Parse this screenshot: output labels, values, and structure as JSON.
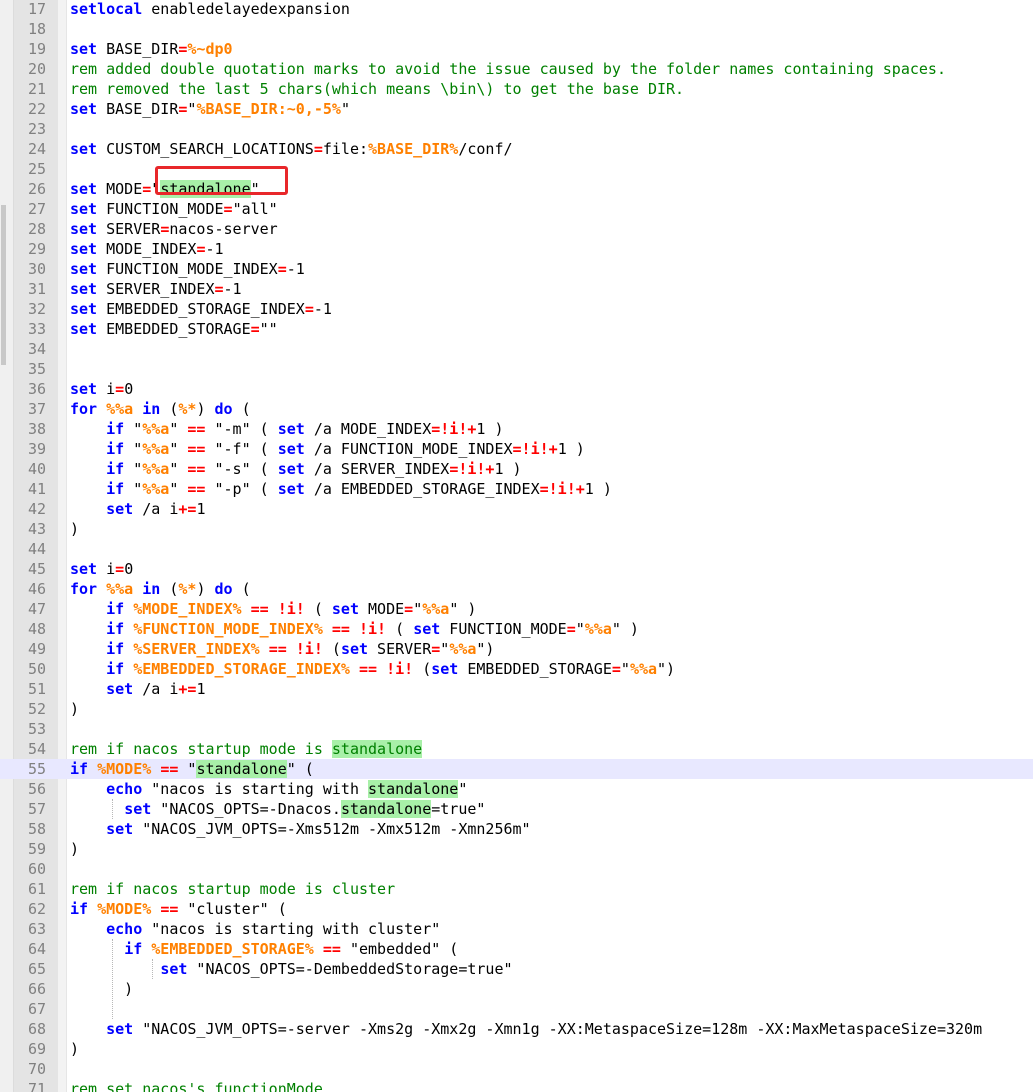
{
  "code_lines": [
    {
      "num": "17",
      "tokens": [
        {
          "c": "kw",
          "t": "setlocal"
        },
        {
          "c": "",
          "t": " enabledelayedexpansion"
        }
      ]
    },
    {
      "num": "18",
      "tokens": []
    },
    {
      "num": "19",
      "tokens": [
        {
          "c": "kw",
          "t": "set"
        },
        {
          "c": "",
          "t": " BASE_DIR"
        },
        {
          "c": "op",
          "t": "="
        },
        {
          "c": "var",
          "t": "%~dp0"
        }
      ]
    },
    {
      "num": "20",
      "tokens": [
        {
          "c": "rem",
          "t": "rem added double quotation marks to avoid the issue caused by the folder names containing spaces."
        }
      ]
    },
    {
      "num": "21",
      "tokens": [
        {
          "c": "rem",
          "t": "rem removed the last 5 chars(which means \\bin\\) to get the base DIR."
        }
      ]
    },
    {
      "num": "22",
      "tokens": [
        {
          "c": "kw",
          "t": "set"
        },
        {
          "c": "",
          "t": " BASE_DIR"
        },
        {
          "c": "op",
          "t": "="
        },
        {
          "c": "",
          "t": "\""
        },
        {
          "c": "var",
          "t": "%BASE_DIR:~0,-5%"
        },
        {
          "c": "",
          "t": "\""
        }
      ]
    },
    {
      "num": "23",
      "tokens": []
    },
    {
      "num": "24",
      "tokens": [
        {
          "c": "kw",
          "t": "set"
        },
        {
          "c": "",
          "t": " CUSTOM_SEARCH_LOCATIONS"
        },
        {
          "c": "op",
          "t": "="
        },
        {
          "c": "",
          "t": "file:"
        },
        {
          "c": "var",
          "t": "%BASE_DIR%"
        },
        {
          "c": "",
          "t": "/conf/"
        }
      ]
    },
    {
      "num": "25",
      "tokens": []
    },
    {
      "num": "26",
      "tokens": [
        {
          "c": "kw",
          "t": "set"
        },
        {
          "c": "",
          "t": " MODE"
        },
        {
          "c": "op",
          "t": "="
        },
        {
          "c": "",
          "t": "\""
        },
        {
          "c": "hl",
          "t": "standalone"
        },
        {
          "c": "",
          "t": "\""
        }
      ]
    },
    {
      "num": "27",
      "tokens": [
        {
          "c": "kw",
          "t": "set"
        },
        {
          "c": "",
          "t": " FUNCTION_MODE"
        },
        {
          "c": "op",
          "t": "="
        },
        {
          "c": "",
          "t": "\"all\""
        }
      ]
    },
    {
      "num": "28",
      "tokens": [
        {
          "c": "kw",
          "t": "set"
        },
        {
          "c": "",
          "t": " SERVER"
        },
        {
          "c": "op",
          "t": "="
        },
        {
          "c": "",
          "t": "nacos-server"
        }
      ]
    },
    {
      "num": "29",
      "tokens": [
        {
          "c": "kw",
          "t": "set"
        },
        {
          "c": "",
          "t": " MODE_INDEX"
        },
        {
          "c": "op",
          "t": "="
        },
        {
          "c": "",
          "t": "-1"
        }
      ]
    },
    {
      "num": "30",
      "tokens": [
        {
          "c": "kw",
          "t": "set"
        },
        {
          "c": "",
          "t": " FUNCTION_MODE_INDEX"
        },
        {
          "c": "op",
          "t": "="
        },
        {
          "c": "",
          "t": "-1"
        }
      ]
    },
    {
      "num": "31",
      "tokens": [
        {
          "c": "kw",
          "t": "set"
        },
        {
          "c": "",
          "t": " SERVER_INDEX"
        },
        {
          "c": "op",
          "t": "="
        },
        {
          "c": "",
          "t": "-1"
        }
      ]
    },
    {
      "num": "32",
      "tokens": [
        {
          "c": "kw",
          "t": "set"
        },
        {
          "c": "",
          "t": " EMBEDDED_STORAGE_INDEX"
        },
        {
          "c": "op",
          "t": "="
        },
        {
          "c": "",
          "t": "-1"
        }
      ]
    },
    {
      "num": "33",
      "tokens": [
        {
          "c": "kw",
          "t": "set"
        },
        {
          "c": "",
          "t": " EMBEDDED_STORAGE"
        },
        {
          "c": "op",
          "t": "="
        },
        {
          "c": "",
          "t": "\"\""
        }
      ]
    },
    {
      "num": "34",
      "tokens": []
    },
    {
      "num": "35",
      "tokens": []
    },
    {
      "num": "36",
      "tokens": [
        {
          "c": "kw",
          "t": "set"
        },
        {
          "c": "",
          "t": " i"
        },
        {
          "c": "op",
          "t": "="
        },
        {
          "c": "",
          "t": "0"
        }
      ]
    },
    {
      "num": "37",
      "tokens": [
        {
          "c": "kw",
          "t": "for"
        },
        {
          "c": "",
          "t": " "
        },
        {
          "c": "var",
          "t": "%%a"
        },
        {
          "c": "",
          "t": " "
        },
        {
          "c": "kw",
          "t": "in"
        },
        {
          "c": "",
          "t": " ("
        },
        {
          "c": "var",
          "t": "%*"
        },
        {
          "c": "",
          "t": ") "
        },
        {
          "c": "kw",
          "t": "do"
        },
        {
          "c": "",
          "t": " ("
        }
      ]
    },
    {
      "num": "38",
      "tokens": [
        {
          "c": "",
          "t": "    "
        },
        {
          "c": "kw",
          "t": "if"
        },
        {
          "c": "",
          "t": " \""
        },
        {
          "c": "var",
          "t": "%%a"
        },
        {
          "c": "",
          "t": "\" "
        },
        {
          "c": "op",
          "t": "=="
        },
        {
          "c": "",
          "t": " \"-m\" ( "
        },
        {
          "c": "kw",
          "t": "set"
        },
        {
          "c": "",
          "t": " /a MODE_INDEX"
        },
        {
          "c": "op",
          "t": "=!i!+"
        },
        {
          "c": "",
          "t": "1 )"
        }
      ]
    },
    {
      "num": "39",
      "tokens": [
        {
          "c": "",
          "t": "    "
        },
        {
          "c": "kw",
          "t": "if"
        },
        {
          "c": "",
          "t": " \""
        },
        {
          "c": "var",
          "t": "%%a"
        },
        {
          "c": "",
          "t": "\" "
        },
        {
          "c": "op",
          "t": "=="
        },
        {
          "c": "",
          "t": " \"-f\" ( "
        },
        {
          "c": "kw",
          "t": "set"
        },
        {
          "c": "",
          "t": " /a FUNCTION_MODE_INDEX"
        },
        {
          "c": "op",
          "t": "=!i!+"
        },
        {
          "c": "",
          "t": "1 )"
        }
      ]
    },
    {
      "num": "40",
      "tokens": [
        {
          "c": "",
          "t": "    "
        },
        {
          "c": "kw",
          "t": "if"
        },
        {
          "c": "",
          "t": " \""
        },
        {
          "c": "var",
          "t": "%%a"
        },
        {
          "c": "",
          "t": "\" "
        },
        {
          "c": "op",
          "t": "=="
        },
        {
          "c": "",
          "t": " \"-s\" ( "
        },
        {
          "c": "kw",
          "t": "set"
        },
        {
          "c": "",
          "t": " /a SERVER_INDEX"
        },
        {
          "c": "op",
          "t": "=!i!+"
        },
        {
          "c": "",
          "t": "1 )"
        }
      ]
    },
    {
      "num": "41",
      "tokens": [
        {
          "c": "",
          "t": "    "
        },
        {
          "c": "kw",
          "t": "if"
        },
        {
          "c": "",
          "t": " \""
        },
        {
          "c": "var",
          "t": "%%a"
        },
        {
          "c": "",
          "t": "\" "
        },
        {
          "c": "op",
          "t": "=="
        },
        {
          "c": "",
          "t": " \"-p\" ( "
        },
        {
          "c": "kw",
          "t": "set"
        },
        {
          "c": "",
          "t": " /a EMBEDDED_STORAGE_INDEX"
        },
        {
          "c": "op",
          "t": "=!i!+"
        },
        {
          "c": "",
          "t": "1 )"
        }
      ]
    },
    {
      "num": "42",
      "tokens": [
        {
          "c": "",
          "t": "    "
        },
        {
          "c": "kw",
          "t": "set"
        },
        {
          "c": "",
          "t": " /a i"
        },
        {
          "c": "op",
          "t": "+="
        },
        {
          "c": "",
          "t": "1"
        }
      ]
    },
    {
      "num": "43",
      "tokens": [
        {
          "c": "",
          "t": ")"
        }
      ]
    },
    {
      "num": "44",
      "tokens": []
    },
    {
      "num": "45",
      "tokens": [
        {
          "c": "kw",
          "t": "set"
        },
        {
          "c": "",
          "t": " i"
        },
        {
          "c": "op",
          "t": "="
        },
        {
          "c": "",
          "t": "0"
        }
      ]
    },
    {
      "num": "46",
      "tokens": [
        {
          "c": "kw",
          "t": "for"
        },
        {
          "c": "",
          "t": " "
        },
        {
          "c": "var",
          "t": "%%a"
        },
        {
          "c": "",
          "t": " "
        },
        {
          "c": "kw",
          "t": "in"
        },
        {
          "c": "",
          "t": " ("
        },
        {
          "c": "var",
          "t": "%*"
        },
        {
          "c": "",
          "t": ") "
        },
        {
          "c": "kw",
          "t": "do"
        },
        {
          "c": "",
          "t": " ("
        }
      ]
    },
    {
      "num": "47",
      "tokens": [
        {
          "c": "",
          "t": "    "
        },
        {
          "c": "kw",
          "t": "if"
        },
        {
          "c": "",
          "t": " "
        },
        {
          "c": "var",
          "t": "%MODE_INDEX%"
        },
        {
          "c": "",
          "t": " "
        },
        {
          "c": "op",
          "t": "== !i!"
        },
        {
          "c": "",
          "t": " ( "
        },
        {
          "c": "kw",
          "t": "set"
        },
        {
          "c": "",
          "t": " MODE"
        },
        {
          "c": "op",
          "t": "="
        },
        {
          "c": "",
          "t": "\""
        },
        {
          "c": "var",
          "t": "%%a"
        },
        {
          "c": "",
          "t": "\" )"
        }
      ]
    },
    {
      "num": "48",
      "tokens": [
        {
          "c": "",
          "t": "    "
        },
        {
          "c": "kw",
          "t": "if"
        },
        {
          "c": "",
          "t": " "
        },
        {
          "c": "var",
          "t": "%FUNCTION_MODE_INDEX%"
        },
        {
          "c": "",
          "t": " "
        },
        {
          "c": "op",
          "t": "== !i!"
        },
        {
          "c": "",
          "t": " ( "
        },
        {
          "c": "kw",
          "t": "set"
        },
        {
          "c": "",
          "t": " FUNCTION_MODE"
        },
        {
          "c": "op",
          "t": "="
        },
        {
          "c": "",
          "t": "\""
        },
        {
          "c": "var",
          "t": "%%a"
        },
        {
          "c": "",
          "t": "\" )"
        }
      ]
    },
    {
      "num": "49",
      "tokens": [
        {
          "c": "",
          "t": "    "
        },
        {
          "c": "kw",
          "t": "if"
        },
        {
          "c": "",
          "t": " "
        },
        {
          "c": "var",
          "t": "%SERVER_INDEX%"
        },
        {
          "c": "",
          "t": " "
        },
        {
          "c": "op",
          "t": "== !i!"
        },
        {
          "c": "",
          "t": " ("
        },
        {
          "c": "kw",
          "t": "set"
        },
        {
          "c": "",
          "t": " SERVER"
        },
        {
          "c": "op",
          "t": "="
        },
        {
          "c": "",
          "t": "\""
        },
        {
          "c": "var",
          "t": "%%a"
        },
        {
          "c": "",
          "t": "\")"
        }
      ]
    },
    {
      "num": "50",
      "tokens": [
        {
          "c": "",
          "t": "    "
        },
        {
          "c": "kw",
          "t": "if"
        },
        {
          "c": "",
          "t": " "
        },
        {
          "c": "var",
          "t": "%EMBEDDED_STORAGE_INDEX%"
        },
        {
          "c": "",
          "t": " "
        },
        {
          "c": "op",
          "t": "== !i!"
        },
        {
          "c": "",
          "t": " ("
        },
        {
          "c": "kw",
          "t": "set"
        },
        {
          "c": "",
          "t": " EMBEDDED_STORAGE"
        },
        {
          "c": "op",
          "t": "="
        },
        {
          "c": "",
          "t": "\""
        },
        {
          "c": "var",
          "t": "%%a"
        },
        {
          "c": "",
          "t": "\")"
        }
      ]
    },
    {
      "num": "51",
      "tokens": [
        {
          "c": "",
          "t": "    "
        },
        {
          "c": "kw",
          "t": "set"
        },
        {
          "c": "",
          "t": " /a i"
        },
        {
          "c": "op",
          "t": "+="
        },
        {
          "c": "",
          "t": "1"
        }
      ]
    },
    {
      "num": "52",
      "tokens": [
        {
          "c": "",
          "t": ")"
        }
      ]
    },
    {
      "num": "53",
      "tokens": []
    },
    {
      "num": "54",
      "tokens": [
        {
          "c": "rem",
          "t": "rem if nacos startup mode is "
        },
        {
          "c": "rem hl",
          "t": "standalone"
        }
      ]
    },
    {
      "num": "55",
      "tokens": [
        {
          "c": "kw",
          "t": "if"
        },
        {
          "c": "",
          "t": " "
        },
        {
          "c": "var",
          "t": "%MODE%"
        },
        {
          "c": "",
          "t": " "
        },
        {
          "c": "op",
          "t": "=="
        },
        {
          "c": "",
          "t": " \""
        },
        {
          "c": "hl",
          "t": "standalone"
        },
        {
          "c": "",
          "t": "\" ("
        }
      ]
    },
    {
      "num": "56",
      "tokens": [
        {
          "c": "",
          "t": "    "
        },
        {
          "c": "kw",
          "t": "echo"
        },
        {
          "c": "",
          "t": " \"nacos is starting with "
        },
        {
          "c": "hl",
          "t": "standalone"
        },
        {
          "c": "",
          "t": "\""
        }
      ]
    },
    {
      "num": "57",
      "tokens": [
        {
          "c": "",
          "t": "      "
        },
        {
          "c": "kw",
          "t": "set"
        },
        {
          "c": "",
          "t": " \"NACOS_OPTS=-Dnacos."
        },
        {
          "c": "hl",
          "t": "standalone"
        },
        {
          "c": "",
          "t": "=true\""
        }
      ]
    },
    {
      "num": "58",
      "tokens": [
        {
          "c": "",
          "t": "    "
        },
        {
          "c": "kw",
          "t": "set"
        },
        {
          "c": "",
          "t": " \"NACOS_JVM_OPTS=-Xms512m -Xmx512m -Xmn256m\""
        }
      ]
    },
    {
      "num": "59",
      "tokens": [
        {
          "c": "",
          "t": ")"
        }
      ]
    },
    {
      "num": "60",
      "tokens": []
    },
    {
      "num": "61",
      "tokens": [
        {
          "c": "rem",
          "t": "rem if nacos startup mode is cluster"
        }
      ]
    },
    {
      "num": "62",
      "tokens": [
        {
          "c": "kw",
          "t": "if"
        },
        {
          "c": "",
          "t": " "
        },
        {
          "c": "var",
          "t": "%MODE%"
        },
        {
          "c": "",
          "t": " "
        },
        {
          "c": "op",
          "t": "=="
        },
        {
          "c": "",
          "t": " \"cluster\" ("
        }
      ]
    },
    {
      "num": "63",
      "tokens": [
        {
          "c": "",
          "t": "    "
        },
        {
          "c": "kw",
          "t": "echo"
        },
        {
          "c": "",
          "t": " \"nacos is starting with cluster\""
        }
      ]
    },
    {
      "num": "64",
      "tokens": [
        {
          "c": "",
          "t": "      "
        },
        {
          "c": "kw",
          "t": "if"
        },
        {
          "c": "",
          "t": " "
        },
        {
          "c": "var",
          "t": "%EMBEDDED_STORAGE%"
        },
        {
          "c": "",
          "t": " "
        },
        {
          "c": "op",
          "t": "=="
        },
        {
          "c": "",
          "t": " \"embedded\" ("
        }
      ]
    },
    {
      "num": "65",
      "tokens": [
        {
          "c": "",
          "t": "          "
        },
        {
          "c": "kw",
          "t": "set"
        },
        {
          "c": "",
          "t": " \"NACOS_OPTS=-DembeddedStorage=true\""
        }
      ]
    },
    {
      "num": "66",
      "tokens": [
        {
          "c": "",
          "t": "      )"
        }
      ]
    },
    {
      "num": "67",
      "tokens": []
    },
    {
      "num": "68",
      "tokens": [
        {
          "c": "",
          "t": "    "
        },
        {
          "c": "kw",
          "t": "set"
        },
        {
          "c": "",
          "t": " \"NACOS_JVM_OPTS=-server -Xms2g -Xmx2g -Xmn1g -XX:MetaspaceSize=128m -XX:MaxMetaspaceSize=320m"
        }
      ]
    },
    {
      "num": "69",
      "tokens": [
        {
          "c": "",
          "t": ")"
        }
      ]
    },
    {
      "num": "70",
      "tokens": []
    },
    {
      "num": "71",
      "tokens": [
        {
          "c": "rem",
          "t": "rem set nacos's functionMode"
        }
      ]
    }
  ],
  "current_line": "55"
}
